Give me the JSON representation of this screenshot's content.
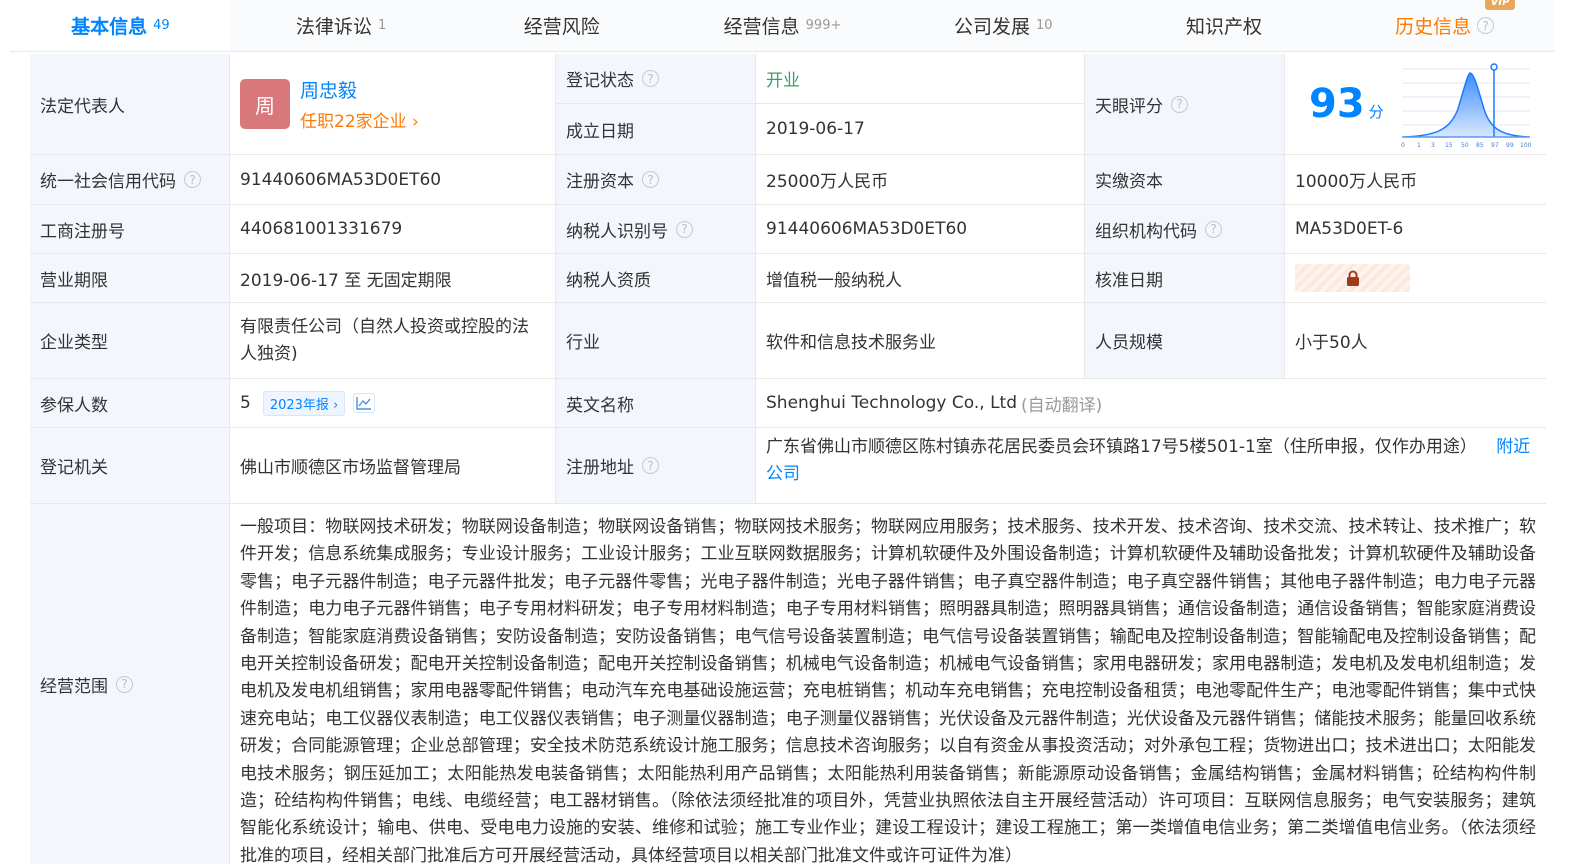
{
  "tabs": [
    {
      "label": "基本信息",
      "count": "49"
    },
    {
      "label": "法律诉讼",
      "count": "1"
    },
    {
      "label": "经营风险",
      "count": ""
    },
    {
      "label": "经营信息",
      "count": "999+"
    },
    {
      "label": "公司发展",
      "count": "10"
    },
    {
      "label": "知识产权",
      "count": ""
    },
    {
      "label": "历史信息",
      "count": "",
      "vip": "VIP"
    }
  ],
  "legal_rep": {
    "label": "法定代表人",
    "avatar_char": "周",
    "name": "周忠毅",
    "positions": "任职22家企业",
    "chevron": "›"
  },
  "reg_status": {
    "label": "登记状态",
    "value": "开业"
  },
  "founded": {
    "label": "成立日期",
    "value": "2019-06-17"
  },
  "tianyan": {
    "label": "天眼评分",
    "score": "93",
    "unit": "分",
    "axis_ticks": [
      "0",
      "1",
      "3",
      "15",
      "50",
      "85",
      "97",
      "99",
      "100"
    ]
  },
  "credit_code": {
    "label": "统一社会信用代码",
    "value": "91440606MA53D0ET60"
  },
  "reg_capital": {
    "label": "注册资本",
    "value": "25000万人民币"
  },
  "paid_capital": {
    "label": "实缴资本",
    "value": "10000万人民币"
  },
  "biz_reg_no": {
    "label": "工商注册号",
    "value": "440681001331679"
  },
  "taxpayer_id": {
    "label": "纳税人识别号",
    "value": "91440606MA53D0ET60"
  },
  "org_code": {
    "label": "组织机构代码",
    "value": "MA53D0ET-6"
  },
  "term": {
    "label": "营业期限",
    "value": "2019-06-17 至 无固定期限"
  },
  "taxpayer_qual": {
    "label": "纳税人资质",
    "value": "增值税一般纳税人"
  },
  "approval_date": {
    "label": "核准日期"
  },
  "company_type": {
    "label": "企业类型",
    "value": "有限责任公司（自然人投资或控股的法人独资)"
  },
  "industry": {
    "label": "行业",
    "value": "软件和信息技术服务业"
  },
  "staff_size": {
    "label": "人员规模",
    "value": "小于50人"
  },
  "insured": {
    "label": "参保人数",
    "value": "5",
    "badge": "2023年报",
    "badge_chevron": "›"
  },
  "english_name": {
    "label": "英文名称",
    "value": "Shenghui Technology Co., Ltd",
    "note": "(自动翻译)"
  },
  "reg_authority": {
    "label": "登记机关",
    "value": "佛山市顺德区市场监督管理局"
  },
  "reg_address": {
    "label": "注册地址",
    "value": "广东省佛山市顺德区陈村镇赤花居民委员会环镇路17号5楼501-1室（住所申报，仅作办用途）",
    "link": "附近公司"
  },
  "scope": {
    "label": "经营范围",
    "text": "一般项目：物联网技术研发；物联网设备制造；物联网设备销售；物联网技术服务；物联网应用服务；技术服务、技术开发、技术咨询、技术交流、技术转让、技术推广；软件开发；信息系统集成服务；专业设计服务；工业设计服务；工业互联网数据服务；计算机软硬件及外围设备制造；计算机软硬件及辅助设备批发；计算机软硬件及辅助设备零售；电子元器件制造；电子元器件批发；电子元器件零售；光电子器件制造；光电子器件销售；电子真空器件制造；电子真空器件销售；其他电子器件制造；电力电子元器件制造；电力电子元器件销售；电子专用材料研发；电子专用材料制造；电子专用材料销售；照明器具制造；照明器具销售；通信设备制造；通信设备销售；智能家庭消费设备制造；智能家庭消费设备销售；安防设备制造；安防设备销售；电气信号设备装置制造；电气信号设备装置销售；输配电及控制设备制造；智能输配电及控制设备销售；配电开关控制设备研发；配电开关控制设备制造；配电开关控制设备销售；机械电气设备制造；机械电气设备销售；家用电器研发；家用电器制造；发电机及发电机组制造；发电机及发电机组销售；家用电器零配件销售；电动汽车充电基础设施运营；充电桩销售；机动车充电销售；充电控制设备租赁；电池零配件生产；电池零配件销售；集中式快速充电站；电工仪器仪表制造；电工仪器仪表销售；电子测量仪器制造；电子测量仪器销售；光伏设备及元器件制造；光伏设备及元器件销售；储能技术服务；能量回收系统研发；合同能源管理；企业总部管理；安全技术防范系统设计施工服务；信息技术咨询服务；以自有资金从事投资活动；对外承包工程；货物进出口；技术进出口；太阳能发电技术服务；钢压延加工；太阳能热发电装备销售；太阳能热利用产品销售；太阳能热利用装备销售；新能源原动设备销售；金属结构销售；金属材料销售；砼结构构件制造；砼结构构件销售；电线、电缆经营；电工器材销售。（除依法须经批准的项目外，凭营业执照依法自主开展经营活动）许可项目：互联网信息服务；电气安装服务；建筑智能化系统设计；输电、供电、受电电力设施的安装、维修和试验；施工专业作业；建设工程设计；建设工程施工；第一类增值电信业务；第二类增值电信业务。（依法须经批准的项目，经相关部门批准后方可开展经营活动，具体经营项目以相关部门批准文件或许可证件为准）"
  },
  "colors": {
    "accent": "#0084ff",
    "orange": "#ff7a00",
    "green": "#2ea66a",
    "label_bg": "#f3f7fd",
    "avatar": "#d9787b"
  },
  "icons": [
    "question-icon",
    "chevron-right-icon",
    "trend-chart-icon",
    "lock-icon"
  ]
}
